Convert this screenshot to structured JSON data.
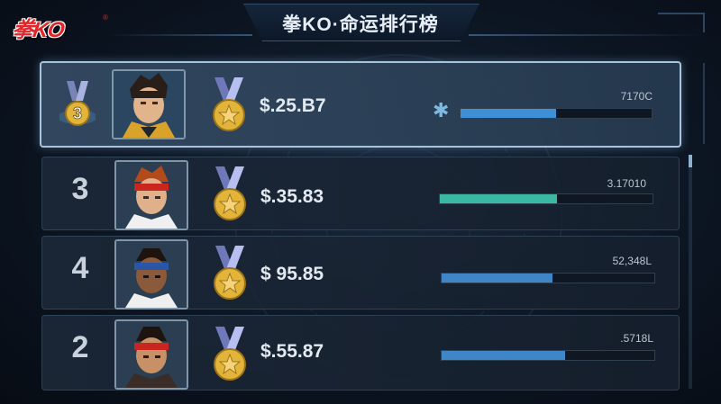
{
  "header": {
    "logo": "拳KO",
    "logo_mark": "®",
    "title": "拳KO·命运排行榜"
  },
  "rows": [
    {
      "rank": "",
      "rank_badge_text": "3",
      "score": "$.25.B7",
      "bar_value": "7170C",
      "bar_fill": 0.5,
      "bar_color": "#3f8fd6",
      "highlighted": true,
      "marker": "✱"
    },
    {
      "rank": "3",
      "score": "$.35.83",
      "bar_value": "3.17010",
      "bar_fill": 0.55,
      "bar_color": "#3ab8a4",
      "highlighted": false
    },
    {
      "rank": "4",
      "score": "$ 95.85",
      "bar_value": "52,348L",
      "bar_fill": 0.52,
      "bar_color": "#3f86c8",
      "highlighted": false
    },
    {
      "rank": "2",
      "score": "$.55.87",
      "bar_value": ".5718L",
      "bar_fill": 0.58,
      "bar_color": "#3f86c8",
      "highlighted": false
    }
  ],
  "icons": {
    "medal": "gold-star-medal-icon",
    "rank_badge": "rank-badge-icon",
    "marker": "asterisk-icon"
  },
  "colors": {
    "accent": "#3f8fd6",
    "teal": "#3ab8a4",
    "logo_red": "#e0262a",
    "gold": "#e2b43a"
  }
}
